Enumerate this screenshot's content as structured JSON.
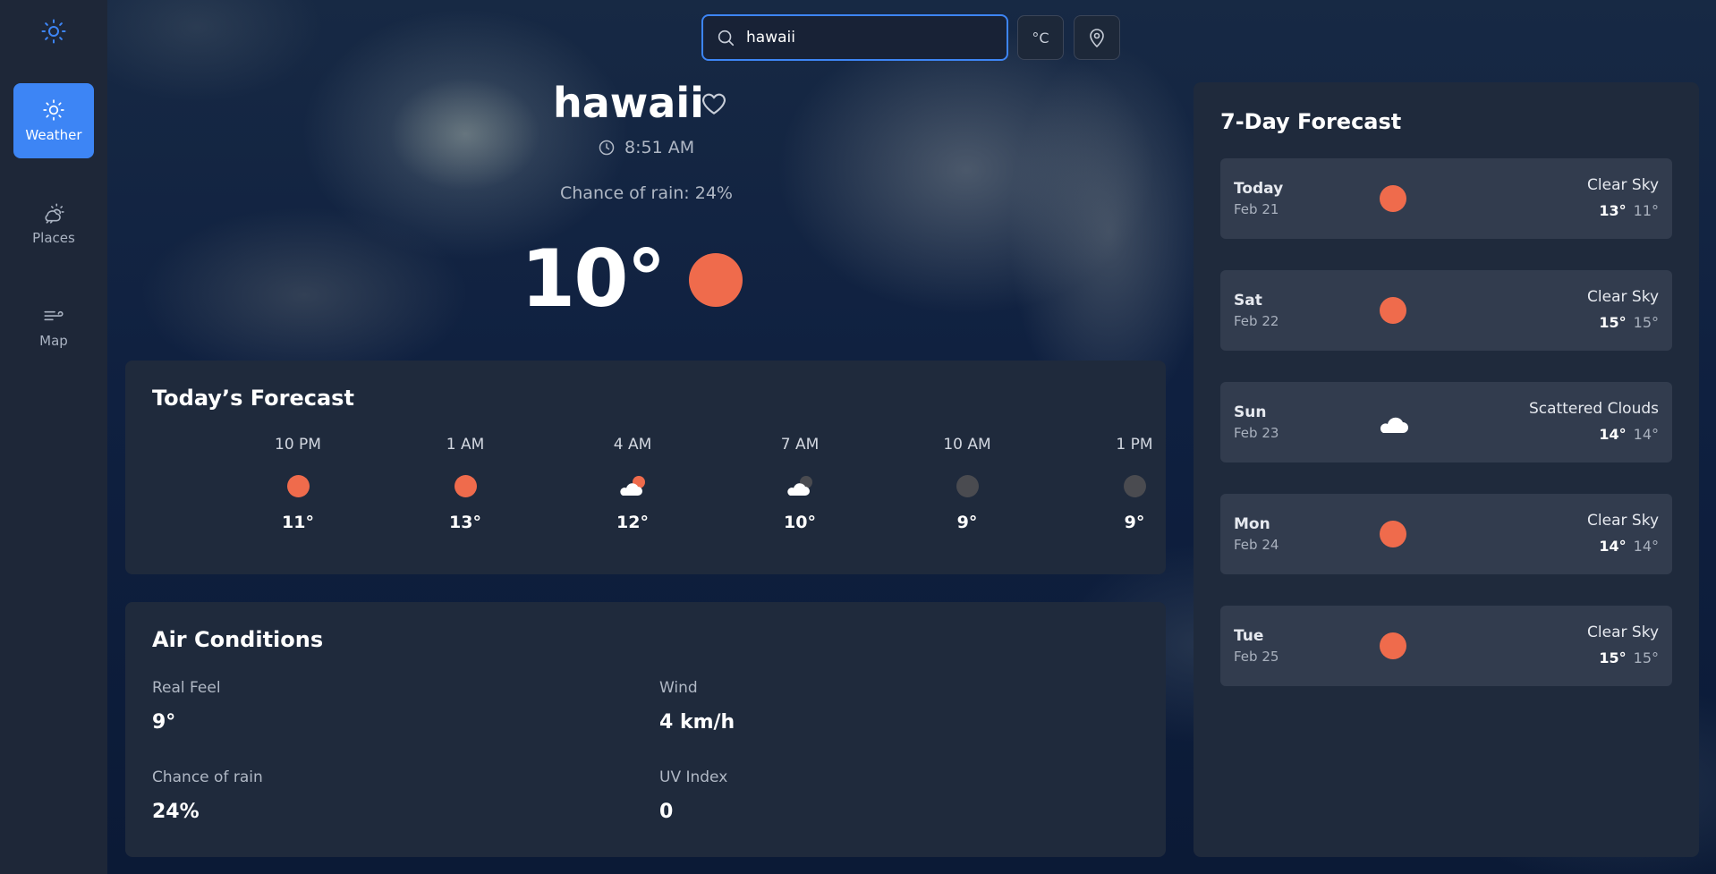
{
  "sidebar": {
    "items": [
      {
        "label": "Weather",
        "icon": "sun-icon",
        "active": true
      },
      {
        "label": "Places",
        "icon": "cloud-sun-icon",
        "active": false
      },
      {
        "label": "Map",
        "icon": "wind-icon",
        "active": false
      }
    ]
  },
  "search": {
    "value": "hawaii",
    "placeholder": ""
  },
  "unit_button": {
    "label": "°C"
  },
  "hero": {
    "city": "hawaii",
    "time": "8:51 AM",
    "rain": "Chance of rain: 24%",
    "temp": "10°"
  },
  "today": {
    "title": "Today’s Forecast",
    "hours": [
      {
        "time": "10 PM",
        "icon": "sun-icon",
        "temp": "11°"
      },
      {
        "time": "1 AM",
        "icon": "sun-icon",
        "temp": "13°"
      },
      {
        "time": "4 AM",
        "icon": "cloud-sun-icon",
        "temp": "12°"
      },
      {
        "time": "7 AM",
        "icon": "cloud-moon-icon",
        "temp": "10°"
      },
      {
        "time": "10 AM",
        "icon": "moon-icon",
        "temp": "9°"
      },
      {
        "time": "1 PM",
        "icon": "moon-icon",
        "temp": "9°"
      }
    ]
  },
  "air": {
    "title": "Air Conditions",
    "metrics": [
      {
        "label": "Real Feel",
        "value": "9°"
      },
      {
        "label": "Wind",
        "value": "4 km/h"
      },
      {
        "label": "Chance of rain",
        "value": "24%"
      },
      {
        "label": "UV Index",
        "value": "0"
      }
    ]
  },
  "week": {
    "title": "7-Day Forecast",
    "days": [
      {
        "name": "Today",
        "date": "Feb 21",
        "icon": "sun-icon",
        "condition": "Clear Sky",
        "high": "13°",
        "low": "11°"
      },
      {
        "name": "Sat",
        "date": "Feb 22",
        "icon": "sun-icon",
        "condition": "Clear Sky",
        "high": "15°",
        "low": "15°"
      },
      {
        "name": "Sun",
        "date": "Feb 23",
        "icon": "cloud-icon",
        "condition": "Scattered Clouds",
        "high": "14°",
        "low": "14°"
      },
      {
        "name": "Mon",
        "date": "Feb 24",
        "icon": "sun-icon",
        "condition": "Clear Sky",
        "high": "14°",
        "low": "14°"
      },
      {
        "name": "Tue",
        "date": "Feb 25",
        "icon": "sun-icon",
        "condition": "Clear Sky",
        "high": "15°",
        "low": "15°"
      }
    ]
  },
  "colors": {
    "accent": "#3d85f5",
    "sun": "#ef6b4c",
    "panel": "#1f2a3c",
    "sidebar": "#1e2738"
  }
}
